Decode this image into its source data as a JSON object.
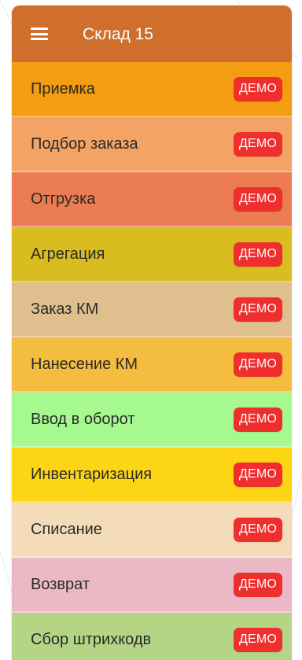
{
  "appbar": {
    "title": "Склад 15",
    "menu_icon": "hamburger-menu-icon",
    "color": "#cf6e2d"
  },
  "badge_text": "ДЕМО",
  "badge_color": "#ef2e2e",
  "items": [
    {
      "label": "Приемка",
      "badge": "ДЕМО",
      "color": "#f49d12"
    },
    {
      "label": "Подбор заказа",
      "badge": "ДЕМО",
      "color": "#f3a465"
    },
    {
      "label": "Отгрузка",
      "badge": "ДЕМО",
      "color": "#ec7d52"
    },
    {
      "label": "Агрегация",
      "badge": "ДЕМО",
      "color": "#d8bc20"
    },
    {
      "label": "Заказ КМ",
      "badge": "ДЕМО",
      "color": "#e0bf8e"
    },
    {
      "label": "Нанесение КМ",
      "badge": "ДЕМО",
      "color": "#f4bd3f"
    },
    {
      "label": "Ввод в оборот",
      "badge": "ДЕМО",
      "color": "#a5f98f"
    },
    {
      "label": "Инвентаризация",
      "badge": "ДЕМО",
      "color": "#fcd514"
    },
    {
      "label": "Списание",
      "badge": "ДЕМО",
      "color": "#f4dcba"
    },
    {
      "label": "Возврат",
      "badge": "ДЕМО",
      "color": "#ebb9c6"
    },
    {
      "label": "Сбор штрихкодв",
      "badge": "ДЕМО",
      "color": "#b3d585"
    }
  ]
}
